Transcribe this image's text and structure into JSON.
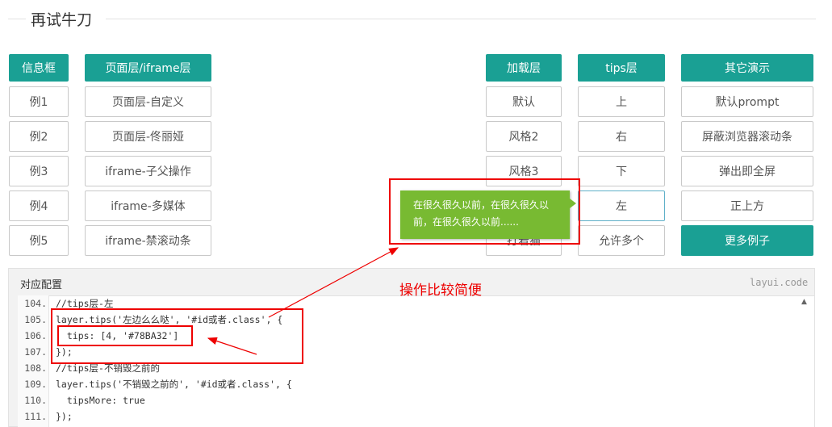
{
  "page": {
    "section_title": "再试牛刀"
  },
  "columns": {
    "dialog": {
      "header": "信息框",
      "items": [
        "例1",
        "例2",
        "例3",
        "例4",
        "例5"
      ]
    },
    "page_layer": {
      "header": "页面层/iframe层",
      "items": [
        "页面层-自定义",
        "页面层-佟丽娅",
        "iframe-子父操作",
        "iframe-多媒体",
        "iframe-禁滚动条"
      ]
    },
    "loading": {
      "header": "加载层",
      "items": [
        "默认",
        "风格2",
        "风格3",
        "打着猫"
      ]
    },
    "tips": {
      "header": "tips层",
      "items": [
        "上",
        "右",
        "下",
        "左",
        "允许多个"
      ]
    },
    "other": {
      "header": "其它演示",
      "items": [
        "默认prompt",
        "屏蔽浏览器滚动条",
        "弹出即全屏",
        "正上方",
        "更多例子"
      ]
    }
  },
  "tip_popup": {
    "text": "在很久很久以前，在很久很久以前，在很久很久以前......",
    "bg_color": "#78BA32"
  },
  "code": {
    "header": "对应配置",
    "brand": "layui.code",
    "lines": [
      {
        "num": "104.",
        "text": "//tips层-左"
      },
      {
        "num": "105.",
        "text": "layer.tips('左边么么哒', '#id或者.class', {"
      },
      {
        "num": "106.",
        "text": "  tips: [4, '#78BA32']"
      },
      {
        "num": "107.",
        "text": "});"
      },
      {
        "num": "108.",
        "text": "//tips层-不销毁之前的"
      },
      {
        "num": "109.",
        "text": "layer.tips('不销毁之前的', '#id或者.class', {"
      },
      {
        "num": "110.",
        "text": "  tipsMore: true"
      },
      {
        "num": "111.",
        "text": "});"
      }
    ]
  },
  "annotation": {
    "text": "操作比较简便",
    "color": "#e00000"
  },
  "colors": {
    "accent": "#1aa094"
  }
}
